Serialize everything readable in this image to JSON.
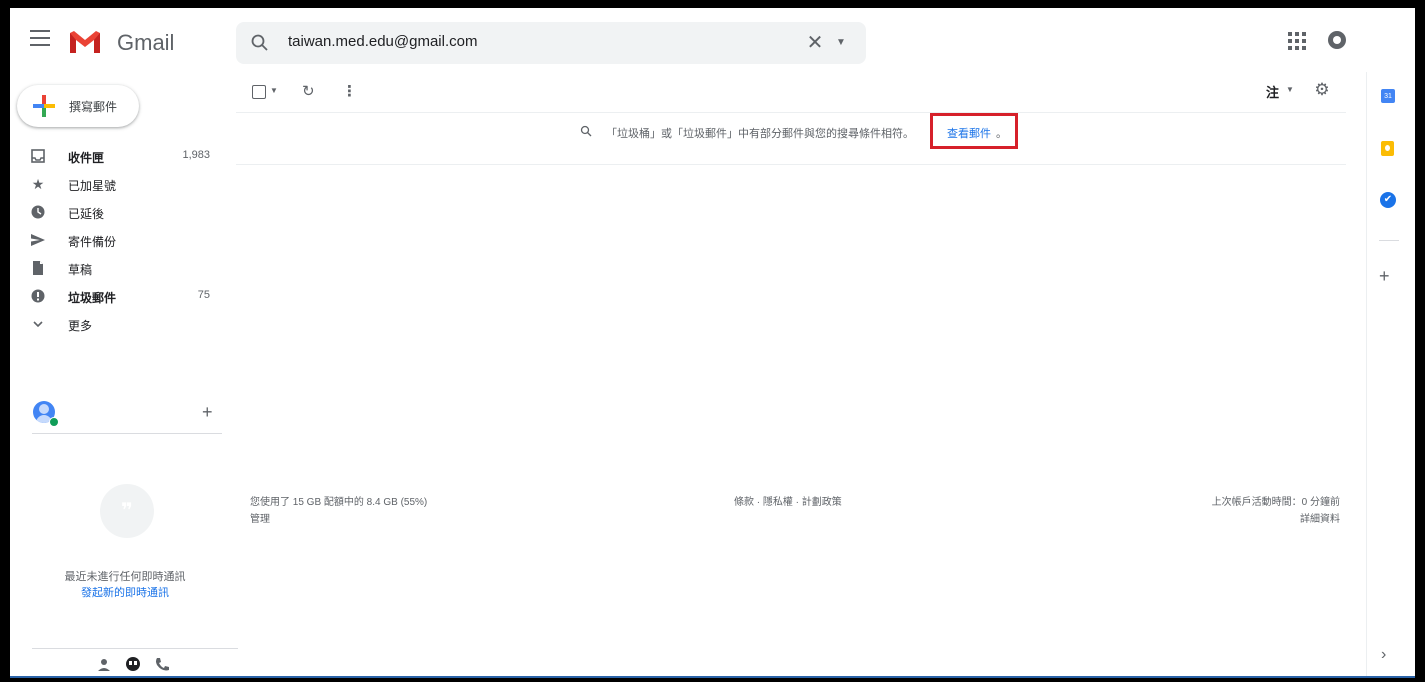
{
  "header": {
    "app_name": "Gmail",
    "search_value": "taiwan.med.edu@gmail.com"
  },
  "compose": {
    "label": "撰寫郵件"
  },
  "nav": {
    "items": [
      {
        "label": "收件匣",
        "count": "1,983",
        "icon": "inbox-icon",
        "bold": true
      },
      {
        "label": "已加星號",
        "count": "",
        "icon": "star-icon",
        "bold": false
      },
      {
        "label": "已延後",
        "count": "",
        "icon": "clock-icon",
        "bold": false
      },
      {
        "label": "寄件備份",
        "count": "",
        "icon": "send-icon",
        "bold": false
      },
      {
        "label": "草稿",
        "count": "",
        "icon": "draft-icon",
        "bold": false
      },
      {
        "label": "垃圾郵件",
        "count": "75",
        "icon": "spam-icon",
        "bold": true
      },
      {
        "label": "更多",
        "count": "",
        "icon": "chevron-down-icon",
        "bold": false
      }
    ]
  },
  "hangouts": {
    "empty_text": "最近未進行任何即時通訊",
    "start_link": "發起新的即時通訊"
  },
  "toolbar": {
    "language_label": "注"
  },
  "notice": {
    "text": "「垃圾桶」或「垃圾郵件」中有部分郵件與您的搜尋條件相符。",
    "link": "查看郵件",
    "suffix": "。"
  },
  "footer": {
    "storage": "您使用了 15 GB 配額中的 8.4 GB (55%)",
    "manage": "管理",
    "terms": "條款 · 隱私權 · 計劃政策",
    "activity": "上次帳戶活動時間：0 分鐘前",
    "details": "詳細資料"
  },
  "side_panel": {
    "calendar_day": "31"
  },
  "colors": {
    "accent": "#1a73e8",
    "highlight_box": "#d6202a",
    "gmail_red": "#ea4335"
  }
}
